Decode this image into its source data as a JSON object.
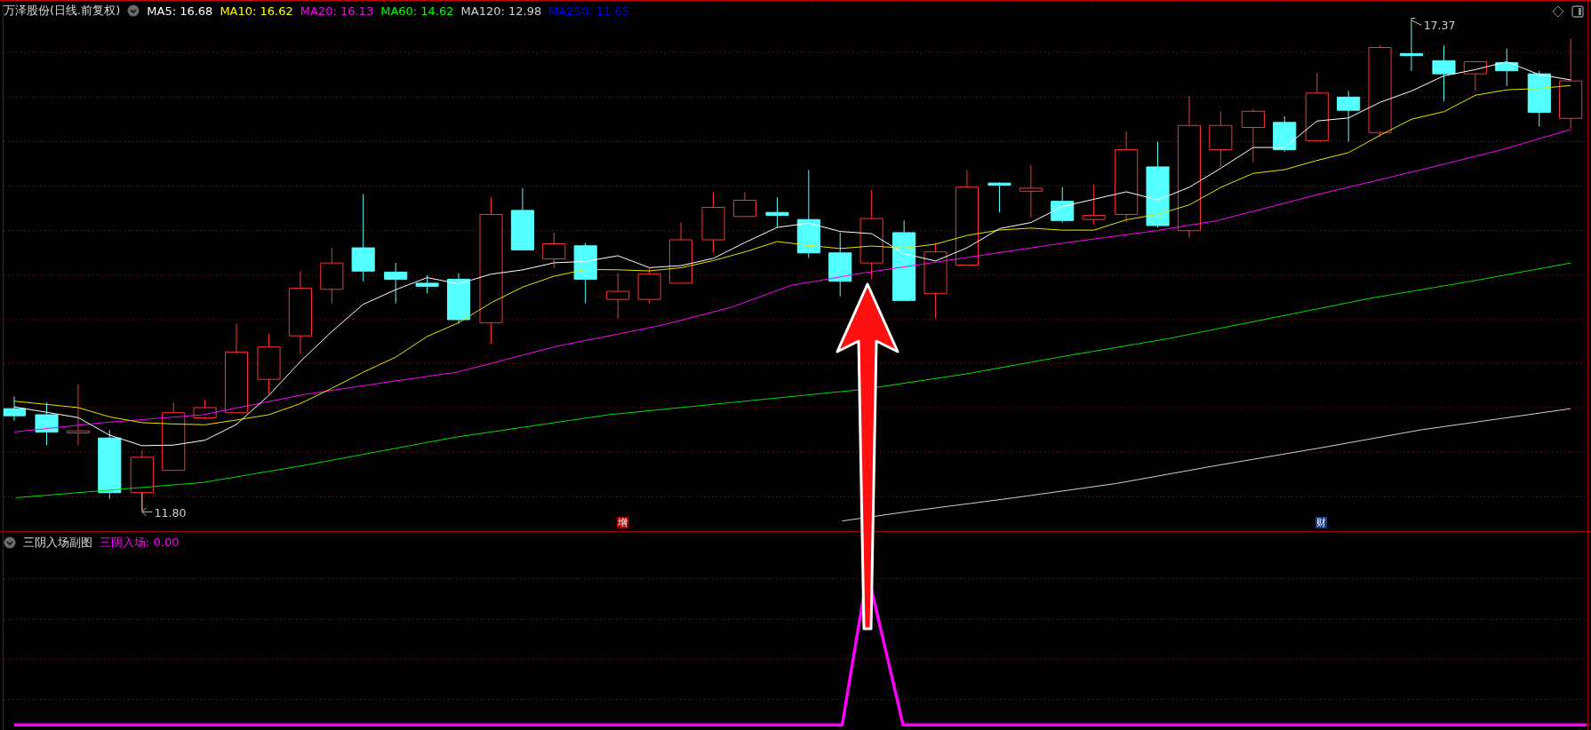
{
  "main_pane": {
    "title": "万泽股份(日线.前复权)",
    "ma_legend": [
      {
        "label": "MA5: 16.68",
        "color": "#ffffff"
      },
      {
        "label": "MA10: 16.62",
        "color": "#ffff00"
      },
      {
        "label": "MA20: 16.13",
        "color": "#ff00ff"
      },
      {
        "label": "MA60: 14.62",
        "color": "#00ff00"
      },
      {
        "label": "MA120: 12.98",
        "color": "#d0d0d0"
      },
      {
        "label": "MA250: 11.65",
        "color": "#0000ff"
      }
    ],
    "high_label": "17.37",
    "low_label": "11.80",
    "event_markers": [
      {
        "text": "增",
        "color": "#a00000"
      },
      {
        "text": "财",
        "color": "#1a3a7a"
      }
    ]
  },
  "sub_pane": {
    "title": "三阴入场副图",
    "indicator": "三阴入场: 0.00"
  }
}
